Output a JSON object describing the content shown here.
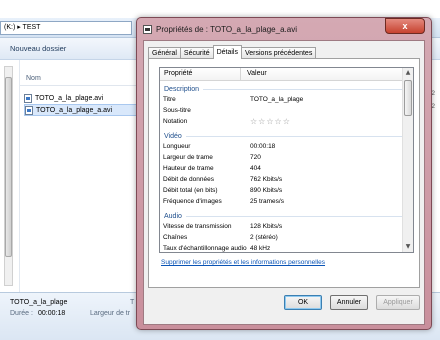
{
  "explorer": {
    "address_path": "(K:) ▸ TEST",
    "new_folder": "Nouveau dossier",
    "col_name": "Nom",
    "files": [
      "TOTO_a_la_plage.avi",
      "TOTO_a_la_plage_a.avi"
    ],
    "right_edges": [
      "7/2",
      "7/2"
    ],
    "details": {
      "name": "TOTO_a_la_plage",
      "duration_label": "Durée :",
      "duration": "00:00:18",
      "frame_width_label": "Largeur de tr",
      "t_label": "T",
      "d_label": "D"
    }
  },
  "dialog": {
    "title": "Propriétés de : TOTO_a_la_plage_a.avi",
    "close_glyph": "x",
    "tabs": [
      "Général",
      "Sécurité",
      "Détails",
      "Versions précédentes"
    ],
    "col_property": "Propriété",
    "col_value": "Valeur",
    "sections": {
      "description": "Description",
      "video": "Vidéo",
      "audio": "Audio"
    },
    "rows": {
      "titre": {
        "k": "Titre",
        "v": "TOTO_a_la_plage"
      },
      "sous_titre": {
        "k": "Sous-titre",
        "v": ""
      },
      "notation": {
        "k": "Notation",
        "stars": "☆☆☆☆☆"
      },
      "longueur": {
        "k": "Longueur",
        "v": "00:00:18"
      },
      "largeur": {
        "k": "Largeur de trame",
        "v": "720"
      },
      "hauteur": {
        "k": "Hauteur de trame",
        "v": "404"
      },
      "debit_donnees": {
        "k": "Débit de données",
        "v": "762 Kbits/s"
      },
      "debit_total": {
        "k": "Débit total (en bits)",
        "v": "890 Kbits/s"
      },
      "frequence": {
        "k": "Fréquence d'images",
        "v": "25 trames/s"
      },
      "vitesse": {
        "k": "Vitesse de transmission",
        "v": "128 Kbits/s"
      },
      "canaux": {
        "k": "Chaînes",
        "v": "2 (stéréo)"
      },
      "taux": {
        "k": "Taux d'échantillonnage audio",
        "v": "48 kHz"
      }
    },
    "remove_link": "Supprimer les propriétés et les informations personnelles",
    "buttons": {
      "ok": "OK",
      "cancel": "Annuler",
      "apply": "Appliquer"
    }
  }
}
